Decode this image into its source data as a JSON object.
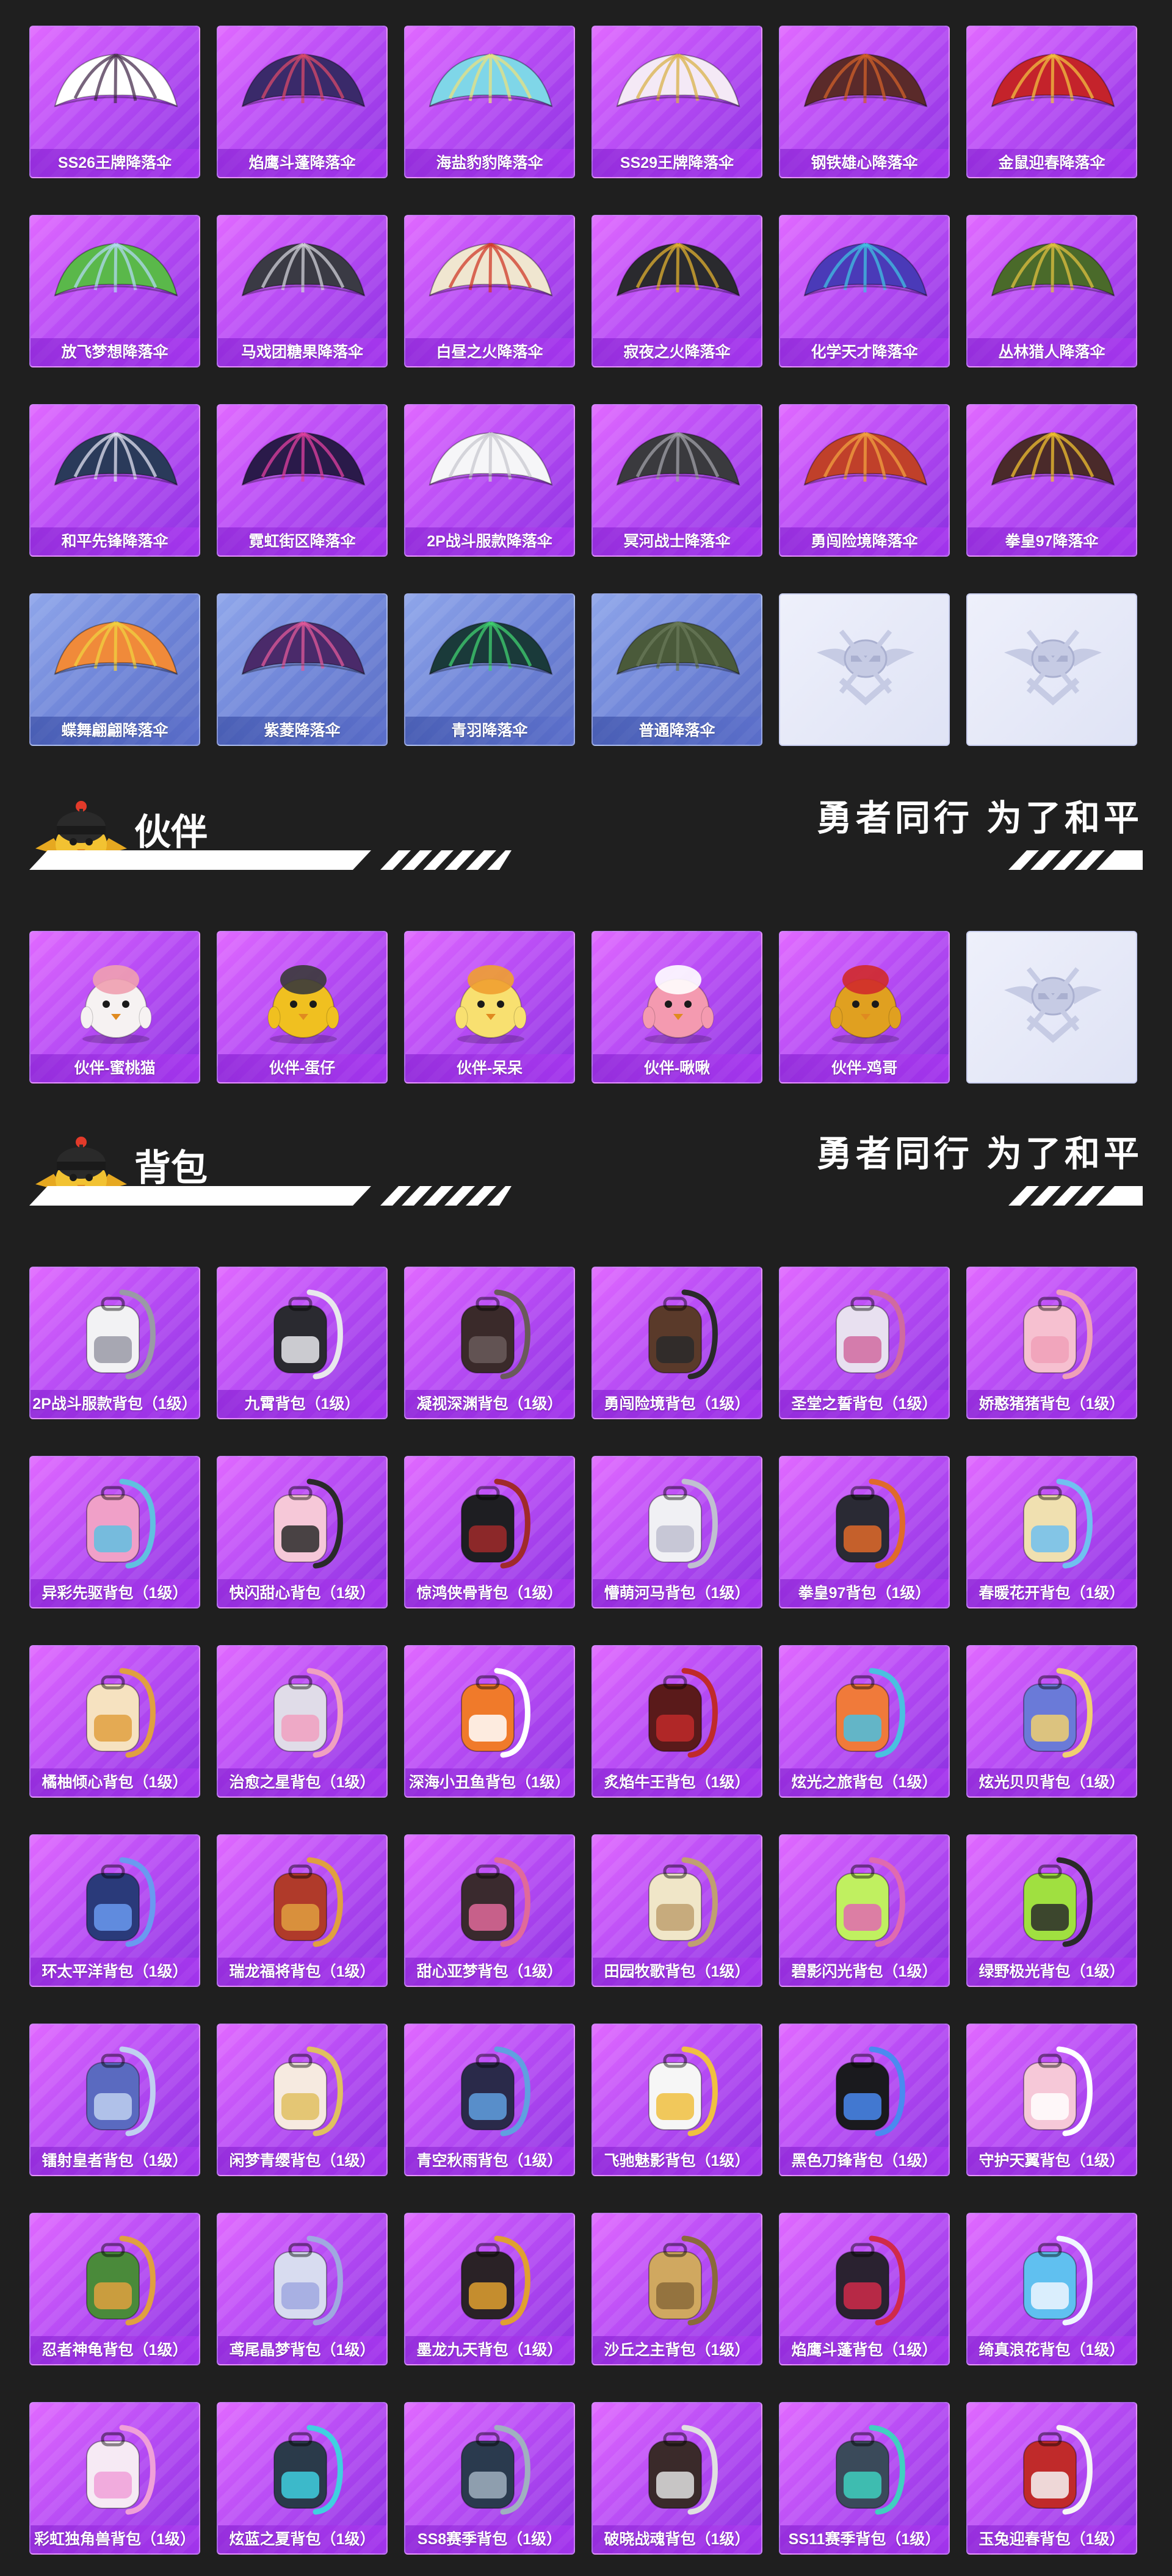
{
  "parachutes": {
    "items": [
      {
        "label": "SS26王牌降落伞",
        "style": "purple",
        "color": "#ffffff",
        "accent": "#4a3050"
      },
      {
        "label": "焰鹰斗蓬降落伞",
        "style": "purple",
        "color": "#3a2a6a",
        "accent": "#d84a6a"
      },
      {
        "label": "海盐豹豹降落伞",
        "style": "purple",
        "color": "#7fd6e8",
        "accent": "#e8e080"
      },
      {
        "label": "SS29王牌降落伞",
        "style": "purple",
        "color": "#f4e9f6",
        "accent": "#d9b24a"
      },
      {
        "label": "钢铁雄心降落伞",
        "style": "purple",
        "color": "#5a2a2a",
        "accent": "#d0602a"
      },
      {
        "label": "金鼠迎春降落伞",
        "style": "purple",
        "color": "#c4232b",
        "accent": "#f0c040"
      },
      {
        "label": "放飞梦想降落伞",
        "style": "purple",
        "color": "#5ab84a",
        "accent": "#b0d8f0"
      },
      {
        "label": "马戏团糖果降落伞",
        "style": "purple",
        "color": "#3a3a44",
        "accent": "#d0d0d8"
      },
      {
        "label": "白昼之火降落伞",
        "style": "purple",
        "color": "#f0e6d0",
        "accent": "#d03a2a"
      },
      {
        "label": "寂夜之火降落伞",
        "style": "purple",
        "color": "#2a2a2e",
        "accent": "#e0b030"
      },
      {
        "label": "化学天才降落伞",
        "style": "purple",
        "color": "#4a3ab8",
        "accent": "#40c0e0"
      },
      {
        "label": "丛林猎人降落伞",
        "style": "purple",
        "color": "#4a6a2a",
        "accent": "#e0c040"
      },
      {
        "label": "和平先锋降落伞",
        "style": "purple",
        "color": "#2a3a5a",
        "accent": "#e0e0f0"
      },
      {
        "label": "霓虹街区降落伞",
        "style": "purple",
        "color": "#2a1a4a",
        "accent": "#e040a0"
      },
      {
        "label": "2P战斗服款降落伞",
        "style": "purple",
        "color": "#f6f6f8",
        "accent": "#c8c8d0"
      },
      {
        "label": "冥河战士降落伞",
        "style": "purple",
        "color": "#3a3a3e",
        "accent": "#a0a0a8"
      },
      {
        "label": "勇闯险境降落伞",
        "style": "purple",
        "color": "#c0402a",
        "accent": "#f0a040"
      },
      {
        "label": "拳皇97降落伞",
        "style": "purple",
        "color": "#4a2a2a",
        "accent": "#f0c030"
      },
      {
        "label": "蝶舞翩翩降落伞",
        "style": "blue",
        "color": "#f08a3a",
        "accent": "#f0d040"
      },
      {
        "label": "紫菱降落伞",
        "style": "blue",
        "color": "#4a2a6a",
        "accent": "#e05a9a"
      },
      {
        "label": "青羽降落伞",
        "style": "blue",
        "color": "#1a3a3a",
        "accent": "#40d070"
      },
      {
        "label": "普通降落伞",
        "style": "blue",
        "color": "#4a5a3a",
        "accent": "#6a7a5a"
      },
      {
        "label": "",
        "style": "empty",
        "color": "#c6cbe4",
        "accent": "#aab0d0"
      },
      {
        "label": "",
        "style": "empty",
        "color": "#c6cbe4",
        "accent": "#aab0d0"
      }
    ]
  },
  "companions": {
    "title": "伙伴",
    "slogan": "勇者同行 为了和平",
    "items": [
      {
        "label": "伙伴-蜜桃猫",
        "style": "purple",
        "color": "#f6f2f2",
        "accent": "#f0a0b0"
      },
      {
        "label": "伙伴-蛋仔",
        "style": "purple",
        "color": "#f0c020",
        "accent": "#3a3a3a"
      },
      {
        "label": "伙伴-呆呆",
        "style": "purple",
        "color": "#f8e070",
        "accent": "#f0a030"
      },
      {
        "label": "伙伴-啾啾",
        "style": "purple",
        "color": "#f49ab0",
        "accent": "#ffffff"
      },
      {
        "label": "伙伴-鸡哥",
        "style": "purple",
        "color": "#e0a020",
        "accent": "#d02a2a"
      },
      {
        "label": "",
        "style": "empty",
        "color": "#c6cbe4",
        "accent": "#aab0d0"
      }
    ]
  },
  "backpacks": {
    "title": "背包",
    "slogan": "勇者同行 为了和平",
    "items": [
      {
        "label": "2P战斗服款背包（1级）",
        "style": "purple",
        "color": "#f2f2f4",
        "accent": "#9a9aa6"
      },
      {
        "label": "九霄背包（1级）",
        "style": "purple",
        "color": "#2a2a30",
        "accent": "#e8e8ec"
      },
      {
        "label": "凝视深渊背包（1级）",
        "style": "purple",
        "color": "#3a2a2a",
        "accent": "#6a5a5a"
      },
      {
        "label": "勇闯险境背包（1级）",
        "style": "purple",
        "color": "#5a3a2a",
        "accent": "#2a2a2a"
      },
      {
        "label": "圣堂之誓背包（1级）",
        "style": "purple",
        "color": "#e8e0f0",
        "accent": "#d06aa0"
      },
      {
        "label": "娇憨猪猪背包（1级）",
        "style": "purple",
        "color": "#f6c0d0",
        "accent": "#f0a0b8"
      },
      {
        "label": "异彩先驱背包（1级）",
        "style": "purple",
        "color": "#f0a0c8",
        "accent": "#60c0e0"
      },
      {
        "label": "快闪甜心背包（1级）",
        "style": "purple",
        "color": "#f6c8d8",
        "accent": "#2a2a2a"
      },
      {
        "label": "惊鸿侠骨背包（1级）",
        "style": "purple",
        "color": "#1e1e22",
        "accent": "#a02a2a"
      },
      {
        "label": "懵萌河马背包（1级）",
        "style": "purple",
        "color": "#f0f0f4",
        "accent": "#c0c0d0"
      },
      {
        "label": "拳皇97背包（1级）",
        "style": "purple",
        "color": "#2a2a34",
        "accent": "#e06a2a"
      },
      {
        "label": "春暖花开背包（1级）",
        "style": "purple",
        "color": "#f0e0b0",
        "accent": "#70c0f0"
      },
      {
        "label": "橘柚倾心背包（1级）",
        "style": "purple",
        "color": "#f6e2c0",
        "accent": "#e0a040"
      },
      {
        "label": "治愈之星背包（1级）",
        "style": "purple",
        "color": "#e0dce8",
        "accent": "#f0a0c0"
      },
      {
        "label": "深海小丑鱼背包（1级）",
        "style": "purple",
        "color": "#f07a2a",
        "accent": "#ffffff"
      },
      {
        "label": "炙焰牛王背包（1级）",
        "style": "purple",
        "color": "#5a1a1a",
        "accent": "#c02a2a"
      },
      {
        "label": "炫光之旅背包（1级）",
        "style": "purple",
        "color": "#f07a3a",
        "accent": "#4ac0e0"
      },
      {
        "label": "炫光贝贝背包（1级）",
        "style": "purple",
        "color": "#6a7ad8",
        "accent": "#f0d070"
      },
      {
        "label": "环太平洋背包（1级）",
        "style": "purple",
        "color": "#2a3a7a",
        "accent": "#6a9af0"
      },
      {
        "label": "瑞龙福将背包（1级）",
        "style": "purple",
        "color": "#b03a2a",
        "accent": "#e0a040"
      },
      {
        "label": "甜心亚梦背包（1级）",
        "style": "purple",
        "color": "#3a2a2e",
        "accent": "#e06a9a"
      },
      {
        "label": "田园牧歌背包（1级）",
        "style": "purple",
        "color": "#f0e6c8",
        "accent": "#c0a070"
      },
      {
        "label": "碧影闪光背包（1级）",
        "style": "purple",
        "color": "#c0f060",
        "accent": "#e06ab0"
      },
      {
        "label": "绿野极光背包（1级）",
        "style": "purple",
        "color": "#a0e040",
        "accent": "#2a2a2a"
      },
      {
        "label": "镭射皇者背包（1级）",
        "style": "purple",
        "color": "#5a6ac0",
        "accent": "#c0d0f0"
      },
      {
        "label": "闲梦青缨背包（1级）",
        "style": "purple",
        "color": "#f6eae0",
        "accent": "#e0c060"
      },
      {
        "label": "青空秋雨背包（1级）",
        "style": "purple",
        "color": "#2a2a4a",
        "accent": "#60a0e0"
      },
      {
        "label": "飞驰魅影背包（1级）",
        "style": "purple",
        "color": "#f6f6f6",
        "accent": "#f0c040"
      },
      {
        "label": "黑色刀锋背包（1级）",
        "style": "purple",
        "color": "#1a1a1e",
        "accent": "#4a8af0"
      },
      {
        "label": "守护天翼背包（1级）",
        "style": "purple",
        "color": "#f6c8d8",
        "accent": "#ffffff"
      },
      {
        "label": "忍者神龟背包（1级）",
        "style": "purple",
        "color": "#4a8a3a",
        "accent": "#e0a040"
      },
      {
        "label": "鸢尾晶梦背包（1级）",
        "style": "purple",
        "color": "#d8dcf0",
        "accent": "#a0a8e0"
      },
      {
        "label": "墨龙九天背包（1级）",
        "style": "purple",
        "color": "#2a2226",
        "accent": "#e0a030"
      },
      {
        "label": "沙丘之主背包（1级）",
        "style": "purple",
        "color": "#d0a860",
        "accent": "#8a6a3a"
      },
      {
        "label": "焰鹰斗蓬背包（1级）",
        "style": "purple",
        "color": "#2a2230",
        "accent": "#d02a4a"
      },
      {
        "label": "绮真浪花背包（1级）",
        "style": "purple",
        "color": "#60c0f0",
        "accent": "#f0f6ff"
      },
      {
        "label": "彩虹独角兽背包（1级）",
        "style": "purple",
        "color": "#f6eaf4",
        "accent": "#f0a0d8"
      },
      {
        "label": "炫蓝之夏背包（1级）",
        "style": "purple",
        "color": "#2a3a4a",
        "accent": "#40d0e0"
      },
      {
        "label": "SS8赛季背包（1级）",
        "style": "purple",
        "color": "#2a3a4e",
        "accent": "#a0b0c0"
      },
      {
        "label": "破晓战魂背包（1级）",
        "style": "purple",
        "color": "#3a2a2a",
        "accent": "#e0e0e0"
      },
      {
        "label": "SS11赛季背包（1级）",
        "style": "purple",
        "color": "#3a4a5a",
        "accent": "#40d0c0"
      },
      {
        "label": "玉兔迎春背包（1级）",
        "style": "purple",
        "color": "#c02a2a",
        "accent": "#f6f6f6"
      }
    ]
  },
  "icons": {
    "mascot": "helmet-chick-mascot-icon",
    "empty_slot": "winged-helmet-emblem-icon"
  },
  "colors": {
    "background": "#1f1f1f",
    "card_purple": "#b94df5",
    "card_blue": "#6f85d8",
    "card_empty": "#e4e7f7"
  }
}
